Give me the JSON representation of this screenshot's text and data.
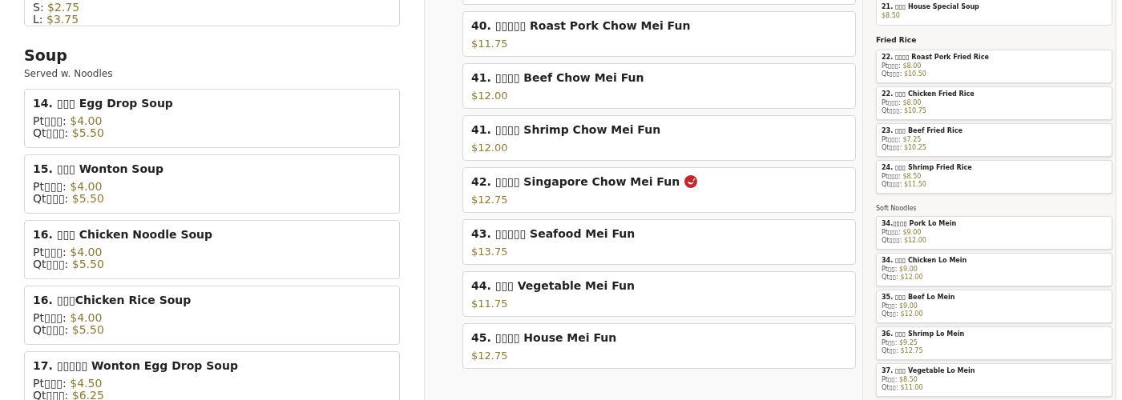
{
  "left": {
    "top_item": {
      "prices": [
        {
          "label": "S:",
          "price": "$2.75"
        },
        {
          "label": "L:",
          "price": "$3.75"
        }
      ]
    },
    "section": {
      "title": "Soup",
      "subtitle": "Served w. Noodles",
      "items": [
        {
          "name": "14. ▯▯▯ Egg Drop Soup",
          "prices": [
            {
              "label": "Pt▯▯▯:",
              "price": "$4.00"
            },
            {
              "label": "Qt▯▯▯:",
              "price": "$5.50"
            }
          ]
        },
        {
          "name": "15. ▯▯▯ Wonton Soup",
          "prices": [
            {
              "label": "Pt▯▯▯:",
              "price": "$4.00"
            },
            {
              "label": "Qt▯▯▯:",
              "price": "$5.50"
            }
          ]
        },
        {
          "name": "16. ▯▯▯ Chicken Noodle Soup",
          "prices": [
            {
              "label": "Pt▯▯▯:",
              "price": "$4.00"
            },
            {
              "label": "Qt▯▯▯:",
              "price": "$5.50"
            }
          ]
        },
        {
          "name": "16. ▯▯▯Chicken Rice Soup",
          "prices": [
            {
              "label": "Pt▯▯▯:",
              "price": "$4.00"
            },
            {
              "label": "Qt▯▯▯:",
              "price": "$5.50"
            }
          ]
        },
        {
          "name": "17. ▯▯▯▯▯ Wonton Egg Drop Soup",
          "prices": [
            {
              "label": "Pt▯▯▯:",
              "price": "$4.50"
            },
            {
              "label": "Qt▯▯▯:",
              "price": "$6.25"
            }
          ]
        }
      ]
    }
  },
  "middle": {
    "items": [
      {
        "name": "40. ▯▯▯▯▯ Roast Pork Chow Mei Fun",
        "price": "$11.75",
        "spicy": false
      },
      {
        "name": "41. ▯▯▯▯ Beef Chow Mei Fun",
        "price": "$12.00",
        "spicy": false
      },
      {
        "name": "41. ▯▯▯▯ Shrimp Chow Mei Fun",
        "price": "$12.00",
        "spicy": false
      },
      {
        "name": "42. ▯▯▯▯ Singapore Chow Mei Fun",
        "price": "$12.75",
        "spicy": true
      },
      {
        "name": "43. ▯▯▯▯▯ Seafood Mei Fun",
        "price": "$13.75",
        "spicy": false
      },
      {
        "name": "44. ▯▯▯ Vegetable Mei Fun",
        "price": "$11.75",
        "spicy": false
      },
      {
        "name": "45. ▯▯▯▯ House Mei Fun",
        "price": "$12.75",
        "spicy": false
      }
    ]
  },
  "right": {
    "top_item": {
      "name": "21. ▯▯▯ House Special Soup",
      "prices": [
        {
          "price": "$8.50"
        }
      ]
    },
    "sections": [
      {
        "title": "Fried Rice",
        "kind": "large",
        "items": [
          {
            "name": "22. ▯▯▯▯ Roast Pork Fried Rice",
            "prices": [
              {
                "label": "Pt▯▯▯:",
                "price": "$8.00"
              },
              {
                "label": "Qt▯▯▯:",
                "price": "$10.50"
              }
            ]
          },
          {
            "name": "22. ▯▯▯ Chicken Fried Rice",
            "prices": [
              {
                "label": "Pt▯▯▯:",
                "price": "$8.00"
              },
              {
                "label": "Qt▯▯▯:",
                "price": "$10.75"
              }
            ]
          },
          {
            "name": "23. ▯▯▯ Beef Fried Rice",
            "prices": [
              {
                "label": "Pt▯▯▯:",
                "price": "$7.25"
              },
              {
                "label": "Qt▯▯▯:",
                "price": "$10.25"
              }
            ]
          },
          {
            "name": "24. ▯▯▯ Shrimp Fried Rice",
            "prices": [
              {
                "label": "Pt▯▯▯:",
                "price": "$8.50"
              },
              {
                "label": "Qt▯▯▯:",
                "price": "$11.50"
              }
            ]
          }
        ]
      },
      {
        "title": "Soft Noodles",
        "kind": "small",
        "items": [
          {
            "name": "34.▯▯▯▯ Pork Lo Mein",
            "prices": [
              {
                "label": "Pt▯▯▯:",
                "price": "$9.00"
              },
              {
                "label": "Qt▯▯▯:",
                "price": "$12.00"
              }
            ]
          },
          {
            "name": "34. ▯▯▯ Chicken Lo Mein",
            "prices": [
              {
                "label": "Pt▯▯:",
                "price": "$9.00"
              },
              {
                "label": "Qt▯▯:",
                "price": "$12.00"
              }
            ]
          },
          {
            "name": "35. ▯▯▯ Beef Lo Mein",
            "prices": [
              {
                "label": "Pt▯▯:",
                "price": "$9.00"
              },
              {
                "label": "Qt▯▯:",
                "price": "$12.00"
              }
            ]
          },
          {
            "name": "36. ▯▯▯ Shrimp Lo Mein",
            "prices": [
              {
                "label": "Pt▯▯:",
                "price": "$9.25"
              },
              {
                "label": "Qt▯▯:",
                "price": "$12.75"
              }
            ]
          },
          {
            "name": "37. ▯▯▯ Vegetable Lo Mein",
            "prices": [
              {
                "label": "Pt▯▯:",
                "price": "$8.50"
              },
              {
                "label": "Qt▯▯:",
                "price": "$11.00"
              }
            ]
          }
        ]
      }
    ]
  }
}
